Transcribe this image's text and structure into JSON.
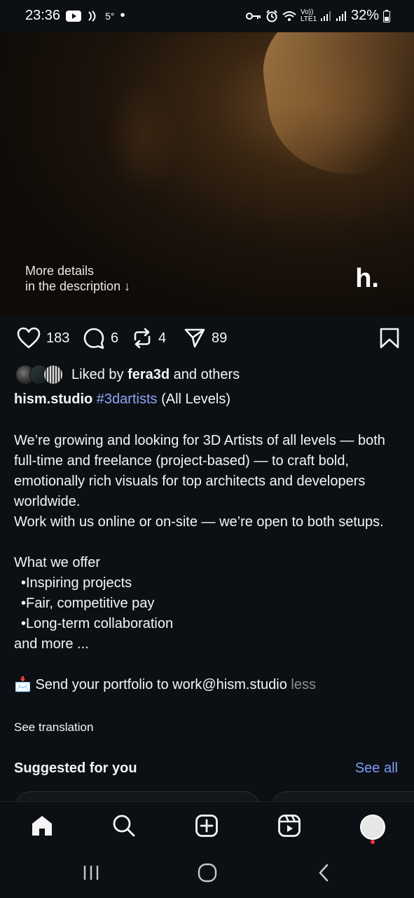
{
  "status_bar": {
    "time": "23:36",
    "temperature": "5°",
    "dot": "•",
    "signal_label": "Vo)) LTE1",
    "battery": "32%"
  },
  "media": {
    "note_line1": "More details",
    "note_line2": "in the description ↓",
    "logo": "h."
  },
  "actions": {
    "likes": "183",
    "comments": "6",
    "reposts": "4",
    "shares": "89"
  },
  "liked_by": {
    "prefix": "Liked by ",
    "user": "fera3d",
    "suffix": " and others"
  },
  "caption": {
    "username": "hism.studio",
    "hashtag": "#3dartists",
    "tag_suffix": " (All Levels)",
    "para1": "We’re growing and looking for 3D Artists of all levels — both full-time and freelance (project-based) — to craft bold, emotionally rich visuals for top architects and developers worldwide.",
    "para2": "Work with us online or on-site — we’re open to both setups.",
    "offer_title": "What we offer",
    "bullets": [
      "•Inspiring projects",
      "•Fair, competitive pay",
      "•Long-term collaboration"
    ],
    "more": "and more ...",
    "send_icon": "📩",
    "send_text": " Send your portfolio to work@hism.studio ",
    "less": "less",
    "see_translation": "See translation"
  },
  "suggested": {
    "title": "Suggested for you",
    "see_all": "See all"
  },
  "bottom_nav": {
    "items": [
      "home-icon",
      "search-icon",
      "create-icon",
      "reels-icon",
      "profile-avatar"
    ]
  },
  "system_nav": {
    "items": [
      "recents-icon",
      "home-circle-icon",
      "back-icon"
    ]
  },
  "colors": {
    "background": "#0c1014",
    "link": "#8fa5f5",
    "see_all": "#7f9cf5",
    "muted": "#8e8e8e",
    "notification_dot": "#ff3040"
  }
}
